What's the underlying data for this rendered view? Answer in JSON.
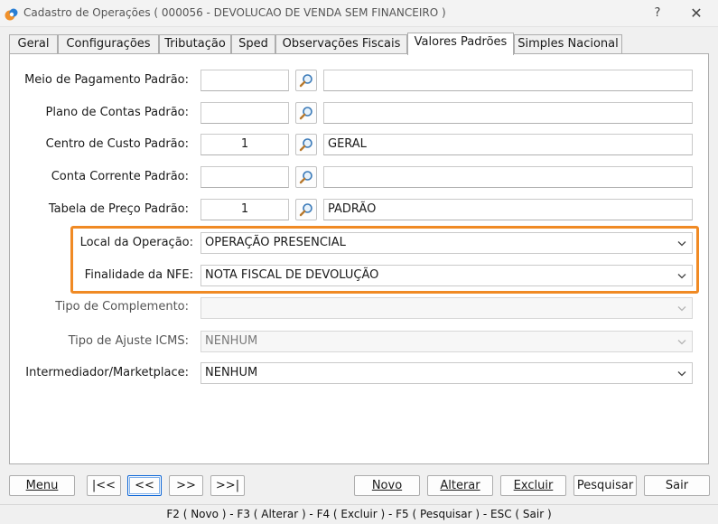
{
  "window": {
    "title": "Cadastro de Operações ( 000056 - DEVOLUCAO DE VENDA SEM FINANCEIRO )",
    "help_label": "?",
    "close_label": "✕"
  },
  "tabs": [
    {
      "label": "Geral"
    },
    {
      "label": "Configurações"
    },
    {
      "label": "Tributação"
    },
    {
      "label": "Sped"
    },
    {
      "label": "Observações Fiscais"
    },
    {
      "label": "Valores Padrões",
      "active": true
    },
    {
      "label": "Simples Nacional"
    }
  ],
  "form": {
    "meio_pagamento": {
      "label": "Meio de Pagamento Padrão:",
      "code": "",
      "description": ""
    },
    "plano_contas": {
      "label": "Plano de Contas Padrão:",
      "code": "",
      "description": ""
    },
    "centro_custo": {
      "label": "Centro de Custo Padrão:",
      "code": "1",
      "description": "GERAL"
    },
    "conta_corrente": {
      "label": "Conta Corrente Padrão:",
      "code": "",
      "description": ""
    },
    "tabela_preco": {
      "label": "Tabela de Preço Padrão:",
      "code": "1",
      "description": "PADRÃO"
    },
    "local_operacao": {
      "label": "Local da Operação:",
      "value": "OPERAÇÃO PRESENCIAL"
    },
    "finalidade_nfe": {
      "label": "Finalidade da NFE:",
      "value": "NOTA FISCAL DE DEVOLUÇÃO"
    },
    "tipo_complemento": {
      "label": "Tipo de Complemento:",
      "value": ""
    },
    "tipo_ajuste_icms": {
      "label": "Tipo de Ajuste ICMS:",
      "value": "NENHUM"
    },
    "intermediador": {
      "label": "Intermediador/Marketplace:",
      "value": "NENHUM"
    }
  },
  "buttons": {
    "menu": "Menu",
    "first": "|<<",
    "prev": "<<",
    "next": ">>",
    "last": ">>|",
    "novo": "Novo",
    "alterar": "Alterar",
    "excluir": "Excluir",
    "pesquisar": "Pesquisar",
    "sair": "Sair"
  },
  "statusbar": {
    "text": "F2 ( Novo )  -  F3 ( Alterar )  -  F4 ( Excluir )  -  F5 ( Pesquisar )  -  ESC ( Sair )"
  },
  "colors": {
    "highlight": "#f08a24",
    "focus": "#0a64d6"
  },
  "icons": {
    "lookup": "magnifier-icon",
    "dropdown": "chevron-down-icon",
    "app": "app-logo-icon"
  }
}
